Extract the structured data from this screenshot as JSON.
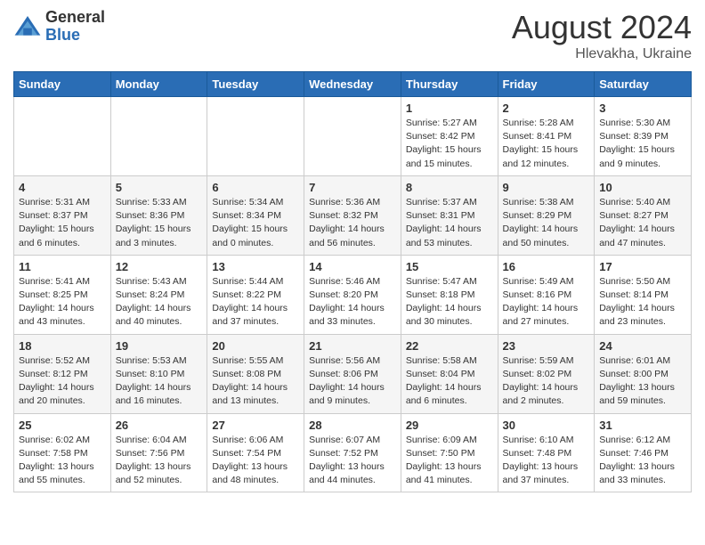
{
  "header": {
    "logo_general": "General",
    "logo_blue": "Blue",
    "title": "August 2024",
    "location": "Hlevakha, Ukraine"
  },
  "weekdays": [
    "Sunday",
    "Monday",
    "Tuesday",
    "Wednesday",
    "Thursday",
    "Friday",
    "Saturday"
  ],
  "weeks": [
    [
      {
        "day": "",
        "info": ""
      },
      {
        "day": "",
        "info": ""
      },
      {
        "day": "",
        "info": ""
      },
      {
        "day": "",
        "info": ""
      },
      {
        "day": "1",
        "info": "Sunrise: 5:27 AM\nSunset: 8:42 PM\nDaylight: 15 hours\nand 15 minutes."
      },
      {
        "day": "2",
        "info": "Sunrise: 5:28 AM\nSunset: 8:41 PM\nDaylight: 15 hours\nand 12 minutes."
      },
      {
        "day": "3",
        "info": "Sunrise: 5:30 AM\nSunset: 8:39 PM\nDaylight: 15 hours\nand 9 minutes."
      }
    ],
    [
      {
        "day": "4",
        "info": "Sunrise: 5:31 AM\nSunset: 8:37 PM\nDaylight: 15 hours\nand 6 minutes."
      },
      {
        "day": "5",
        "info": "Sunrise: 5:33 AM\nSunset: 8:36 PM\nDaylight: 15 hours\nand 3 minutes."
      },
      {
        "day": "6",
        "info": "Sunrise: 5:34 AM\nSunset: 8:34 PM\nDaylight: 15 hours\nand 0 minutes."
      },
      {
        "day": "7",
        "info": "Sunrise: 5:36 AM\nSunset: 8:32 PM\nDaylight: 14 hours\nand 56 minutes."
      },
      {
        "day": "8",
        "info": "Sunrise: 5:37 AM\nSunset: 8:31 PM\nDaylight: 14 hours\nand 53 minutes."
      },
      {
        "day": "9",
        "info": "Sunrise: 5:38 AM\nSunset: 8:29 PM\nDaylight: 14 hours\nand 50 minutes."
      },
      {
        "day": "10",
        "info": "Sunrise: 5:40 AM\nSunset: 8:27 PM\nDaylight: 14 hours\nand 47 minutes."
      }
    ],
    [
      {
        "day": "11",
        "info": "Sunrise: 5:41 AM\nSunset: 8:25 PM\nDaylight: 14 hours\nand 43 minutes."
      },
      {
        "day": "12",
        "info": "Sunrise: 5:43 AM\nSunset: 8:24 PM\nDaylight: 14 hours\nand 40 minutes."
      },
      {
        "day": "13",
        "info": "Sunrise: 5:44 AM\nSunset: 8:22 PM\nDaylight: 14 hours\nand 37 minutes."
      },
      {
        "day": "14",
        "info": "Sunrise: 5:46 AM\nSunset: 8:20 PM\nDaylight: 14 hours\nand 33 minutes."
      },
      {
        "day": "15",
        "info": "Sunrise: 5:47 AM\nSunset: 8:18 PM\nDaylight: 14 hours\nand 30 minutes."
      },
      {
        "day": "16",
        "info": "Sunrise: 5:49 AM\nSunset: 8:16 PM\nDaylight: 14 hours\nand 27 minutes."
      },
      {
        "day": "17",
        "info": "Sunrise: 5:50 AM\nSunset: 8:14 PM\nDaylight: 14 hours\nand 23 minutes."
      }
    ],
    [
      {
        "day": "18",
        "info": "Sunrise: 5:52 AM\nSunset: 8:12 PM\nDaylight: 14 hours\nand 20 minutes."
      },
      {
        "day": "19",
        "info": "Sunrise: 5:53 AM\nSunset: 8:10 PM\nDaylight: 14 hours\nand 16 minutes."
      },
      {
        "day": "20",
        "info": "Sunrise: 5:55 AM\nSunset: 8:08 PM\nDaylight: 14 hours\nand 13 minutes."
      },
      {
        "day": "21",
        "info": "Sunrise: 5:56 AM\nSunset: 8:06 PM\nDaylight: 14 hours\nand 9 minutes."
      },
      {
        "day": "22",
        "info": "Sunrise: 5:58 AM\nSunset: 8:04 PM\nDaylight: 14 hours\nand 6 minutes."
      },
      {
        "day": "23",
        "info": "Sunrise: 5:59 AM\nSunset: 8:02 PM\nDaylight: 14 hours\nand 2 minutes."
      },
      {
        "day": "24",
        "info": "Sunrise: 6:01 AM\nSunset: 8:00 PM\nDaylight: 13 hours\nand 59 minutes."
      }
    ],
    [
      {
        "day": "25",
        "info": "Sunrise: 6:02 AM\nSunset: 7:58 PM\nDaylight: 13 hours\nand 55 minutes."
      },
      {
        "day": "26",
        "info": "Sunrise: 6:04 AM\nSunset: 7:56 PM\nDaylight: 13 hours\nand 52 minutes."
      },
      {
        "day": "27",
        "info": "Sunrise: 6:06 AM\nSunset: 7:54 PM\nDaylight: 13 hours\nand 48 minutes."
      },
      {
        "day": "28",
        "info": "Sunrise: 6:07 AM\nSunset: 7:52 PM\nDaylight: 13 hours\nand 44 minutes."
      },
      {
        "day": "29",
        "info": "Sunrise: 6:09 AM\nSunset: 7:50 PM\nDaylight: 13 hours\nand 41 minutes."
      },
      {
        "day": "30",
        "info": "Sunrise: 6:10 AM\nSunset: 7:48 PM\nDaylight: 13 hours\nand 37 minutes."
      },
      {
        "day": "31",
        "info": "Sunrise: 6:12 AM\nSunset: 7:46 PM\nDaylight: 13 hours\nand 33 minutes."
      }
    ]
  ]
}
